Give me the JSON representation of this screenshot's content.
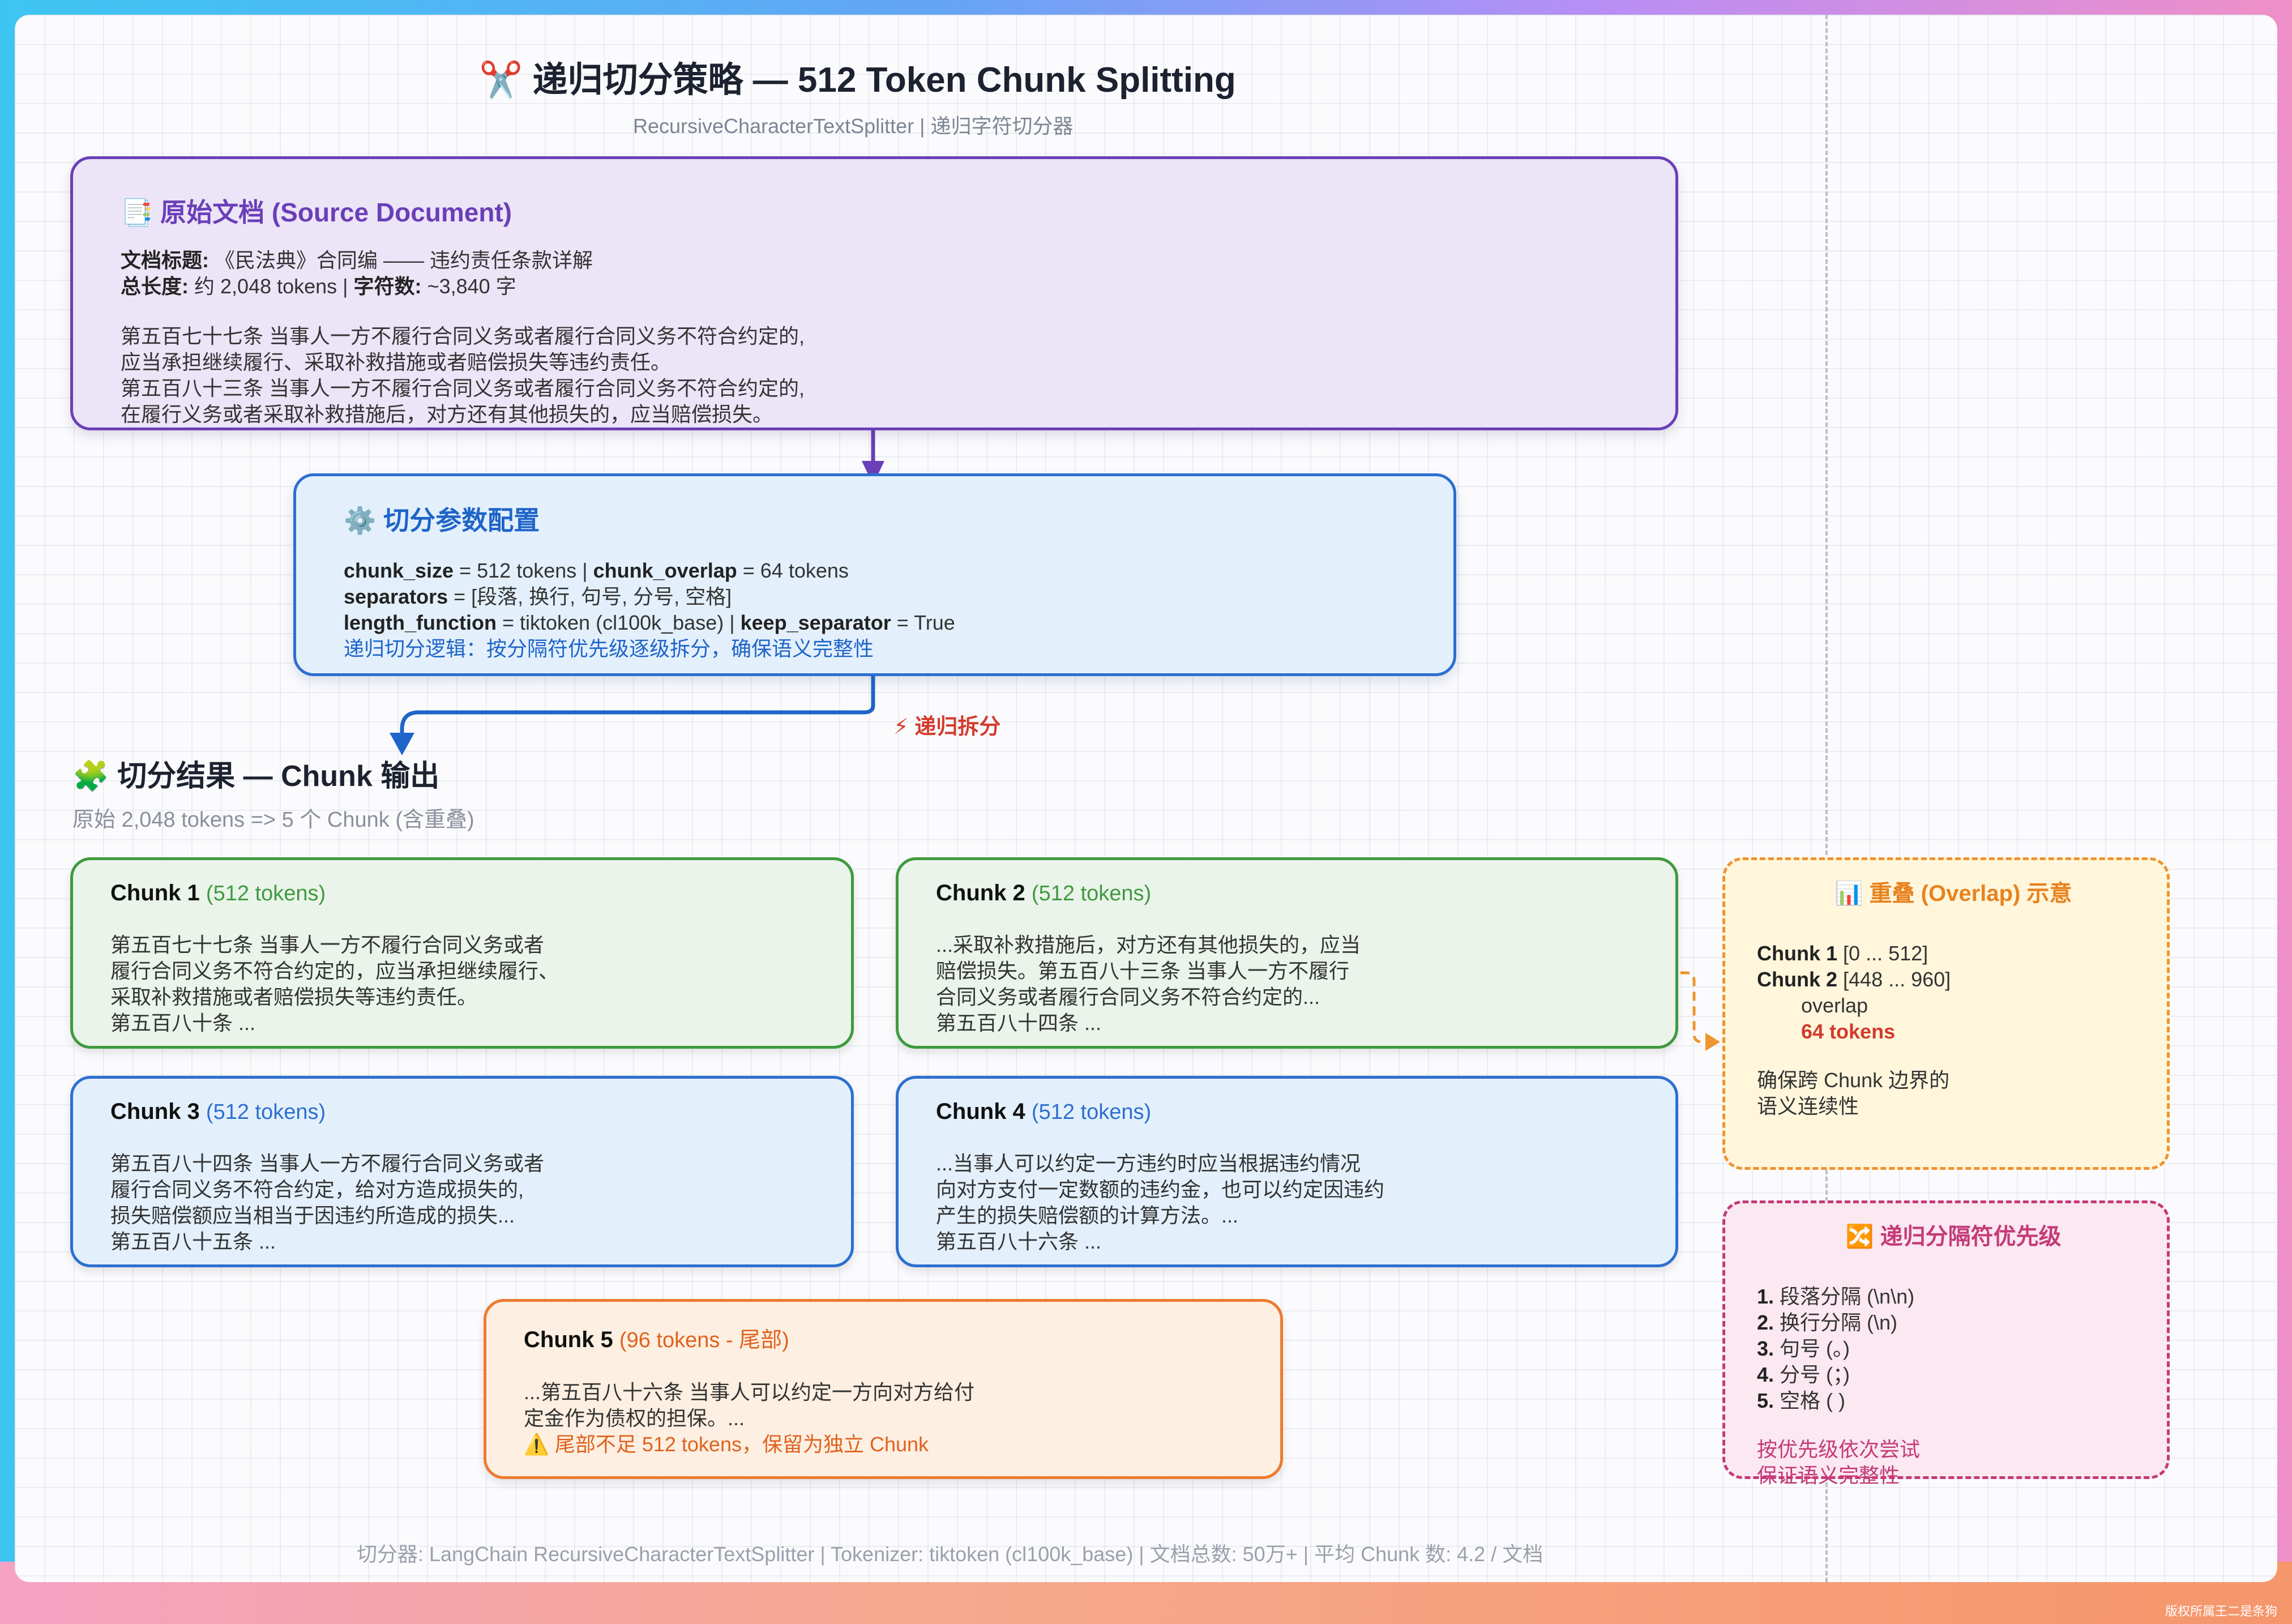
{
  "header": {
    "title_icon": "✂️",
    "title": "递归切分策略 — 512 Token Chunk Splitting",
    "subtitle": "RecursiveCharacterTextSplitter | 递归字符切分器"
  },
  "source": {
    "icon": "📑",
    "heading": "原始文档 (Source Document)",
    "doc_title_label": "文档标题:",
    "doc_title_value": "《民法典》合同编 —— 违约责任条款详解",
    "length_label": "总长度:",
    "length_value": "约 2,048 tokens |",
    "chars_label": "字符数:",
    "chars_value": "~3,840 字",
    "excerpt": [
      "第五百七十七条 当事人一方不履行合同义务或者履行合同义务不符合约定的,",
      "应当承担继续履行、采取补救措施或者赔偿损失等违约责任。",
      "第五百八十三条 当事人一方不履行合同义务或者履行合同义务不符合约定的,",
      "在履行义务或者采取补救措施后，对方还有其他损失的，应当赔偿损失。"
    ]
  },
  "config": {
    "icon": "⚙️",
    "heading": "切分参数配置",
    "k_chunk_size": "chunk_size",
    "v_chunk_size": "= 512 tokens |",
    "k_overlap": "chunk_overlap",
    "v_overlap": "= 64 tokens",
    "k_separators": "separators",
    "v_separators": "= [段落, 换行, 句号, 分号, 空格]",
    "k_length_fn": "length_function",
    "v_length_fn": "= tiktoken (cl100k_base) |",
    "k_keep": "keep_separator",
    "v_keep": "= True",
    "logic": "递归切分逻辑：按分隔符优先级逐级拆分，确保语义完整性"
  },
  "recursive_label": "⚡ 递归拆分",
  "results": {
    "icon": "🧩",
    "title": "切分结果 — Chunk 输出",
    "subtitle": "原始 2,048 tokens => 5 个 Chunk (含重叠)"
  },
  "chunks": [
    {
      "name": "Chunk 1",
      "tokens": "(512 tokens)",
      "lines": [
        "第五百七十七条 当事人一方不履行合同义务或者",
        "履行合同义务不符合约定的，应当承担继续履行、",
        "采取补救措施或者赔偿损失等违约责任。",
        "第五百八十条 ..."
      ]
    },
    {
      "name": "Chunk 2",
      "tokens": "(512 tokens)",
      "lines": [
        "...采取补救措施后，对方还有其他损失的，应当",
        "赔偿损失。第五百八十三条 当事人一方不履行",
        "合同义务或者履行合同义务不符合约定的...",
        "第五百八十四条 ..."
      ]
    },
    {
      "name": "Chunk 3",
      "tokens": "(512 tokens)",
      "lines": [
        "第五百八十四条 当事人一方不履行合同义务或者",
        "履行合同义务不符合约定，给对方造成损失的,",
        "损失赔偿额应当相当于因违约所造成的损失...",
        "第五百八十五条 ..."
      ]
    },
    {
      "name": "Chunk 4",
      "tokens": "(512 tokens)",
      "lines": [
        "...当事人可以约定一方违约时应当根据违约情况",
        "向对方支付一定数额的违约金，也可以约定因违约",
        "产生的损失赔偿额的计算方法。...",
        "第五百八十六条 ..."
      ]
    },
    {
      "name": "Chunk 5",
      "tokens": "(96 tokens - 尾部)",
      "lines": [
        "...第五百八十六条 当事人可以约定一方向对方给付",
        "定金作为债权的担保。..."
      ],
      "warning": "⚠️ 尾部不足 512 tokens，保留为独立 Chunk"
    }
  ],
  "overlap": {
    "icon": "📊",
    "heading": "重叠 (Overlap) 示意",
    "c1_name": "Chunk 1",
    "c1_range": "[0 ... 512]",
    "c2_name": "Chunk 2",
    "c2_range": "[448 ... 960]",
    "overlap_word": "overlap",
    "overlap_tokens": "64 tokens",
    "note": [
      "确保跨 Chunk 边界的",
      "语义连续性"
    ]
  },
  "separators": {
    "icon": "🔀",
    "heading": "递归分隔符优先级",
    "items": [
      {
        "num": "1.",
        "text": "段落分隔 (\\n\\n)"
      },
      {
        "num": "2.",
        "text": "换行分隔 (\\n)"
      },
      {
        "num": "3.",
        "text": "句号 (。)"
      },
      {
        "num": "4.",
        "text": "分号 (；)"
      },
      {
        "num": "5.",
        "text": "空格 ( )"
      }
    ],
    "note": [
      "按优先级依次尝试",
      "保证语义完整性"
    ]
  },
  "footer": "切分器: LangChain RecursiveCharacterTextSplitter | Tokenizer: tiktoken (cl100k_base) | 文档总数: 50万+ | 平均 Chunk 数: 4.2 / 文档",
  "watermark": "版权所属王二是条狗",
  "colors": {
    "source_border": "#6a3fb8",
    "config_border": "#2d6fd0",
    "chunk_green": "#3f9a3f",
    "chunk_blue": "#2d6fd0",
    "chunk_orange": "#ee7a30",
    "overlap_orange": "#ee9430",
    "separator_pink": "#c43a78",
    "alert_red": "#d33a2c"
  }
}
